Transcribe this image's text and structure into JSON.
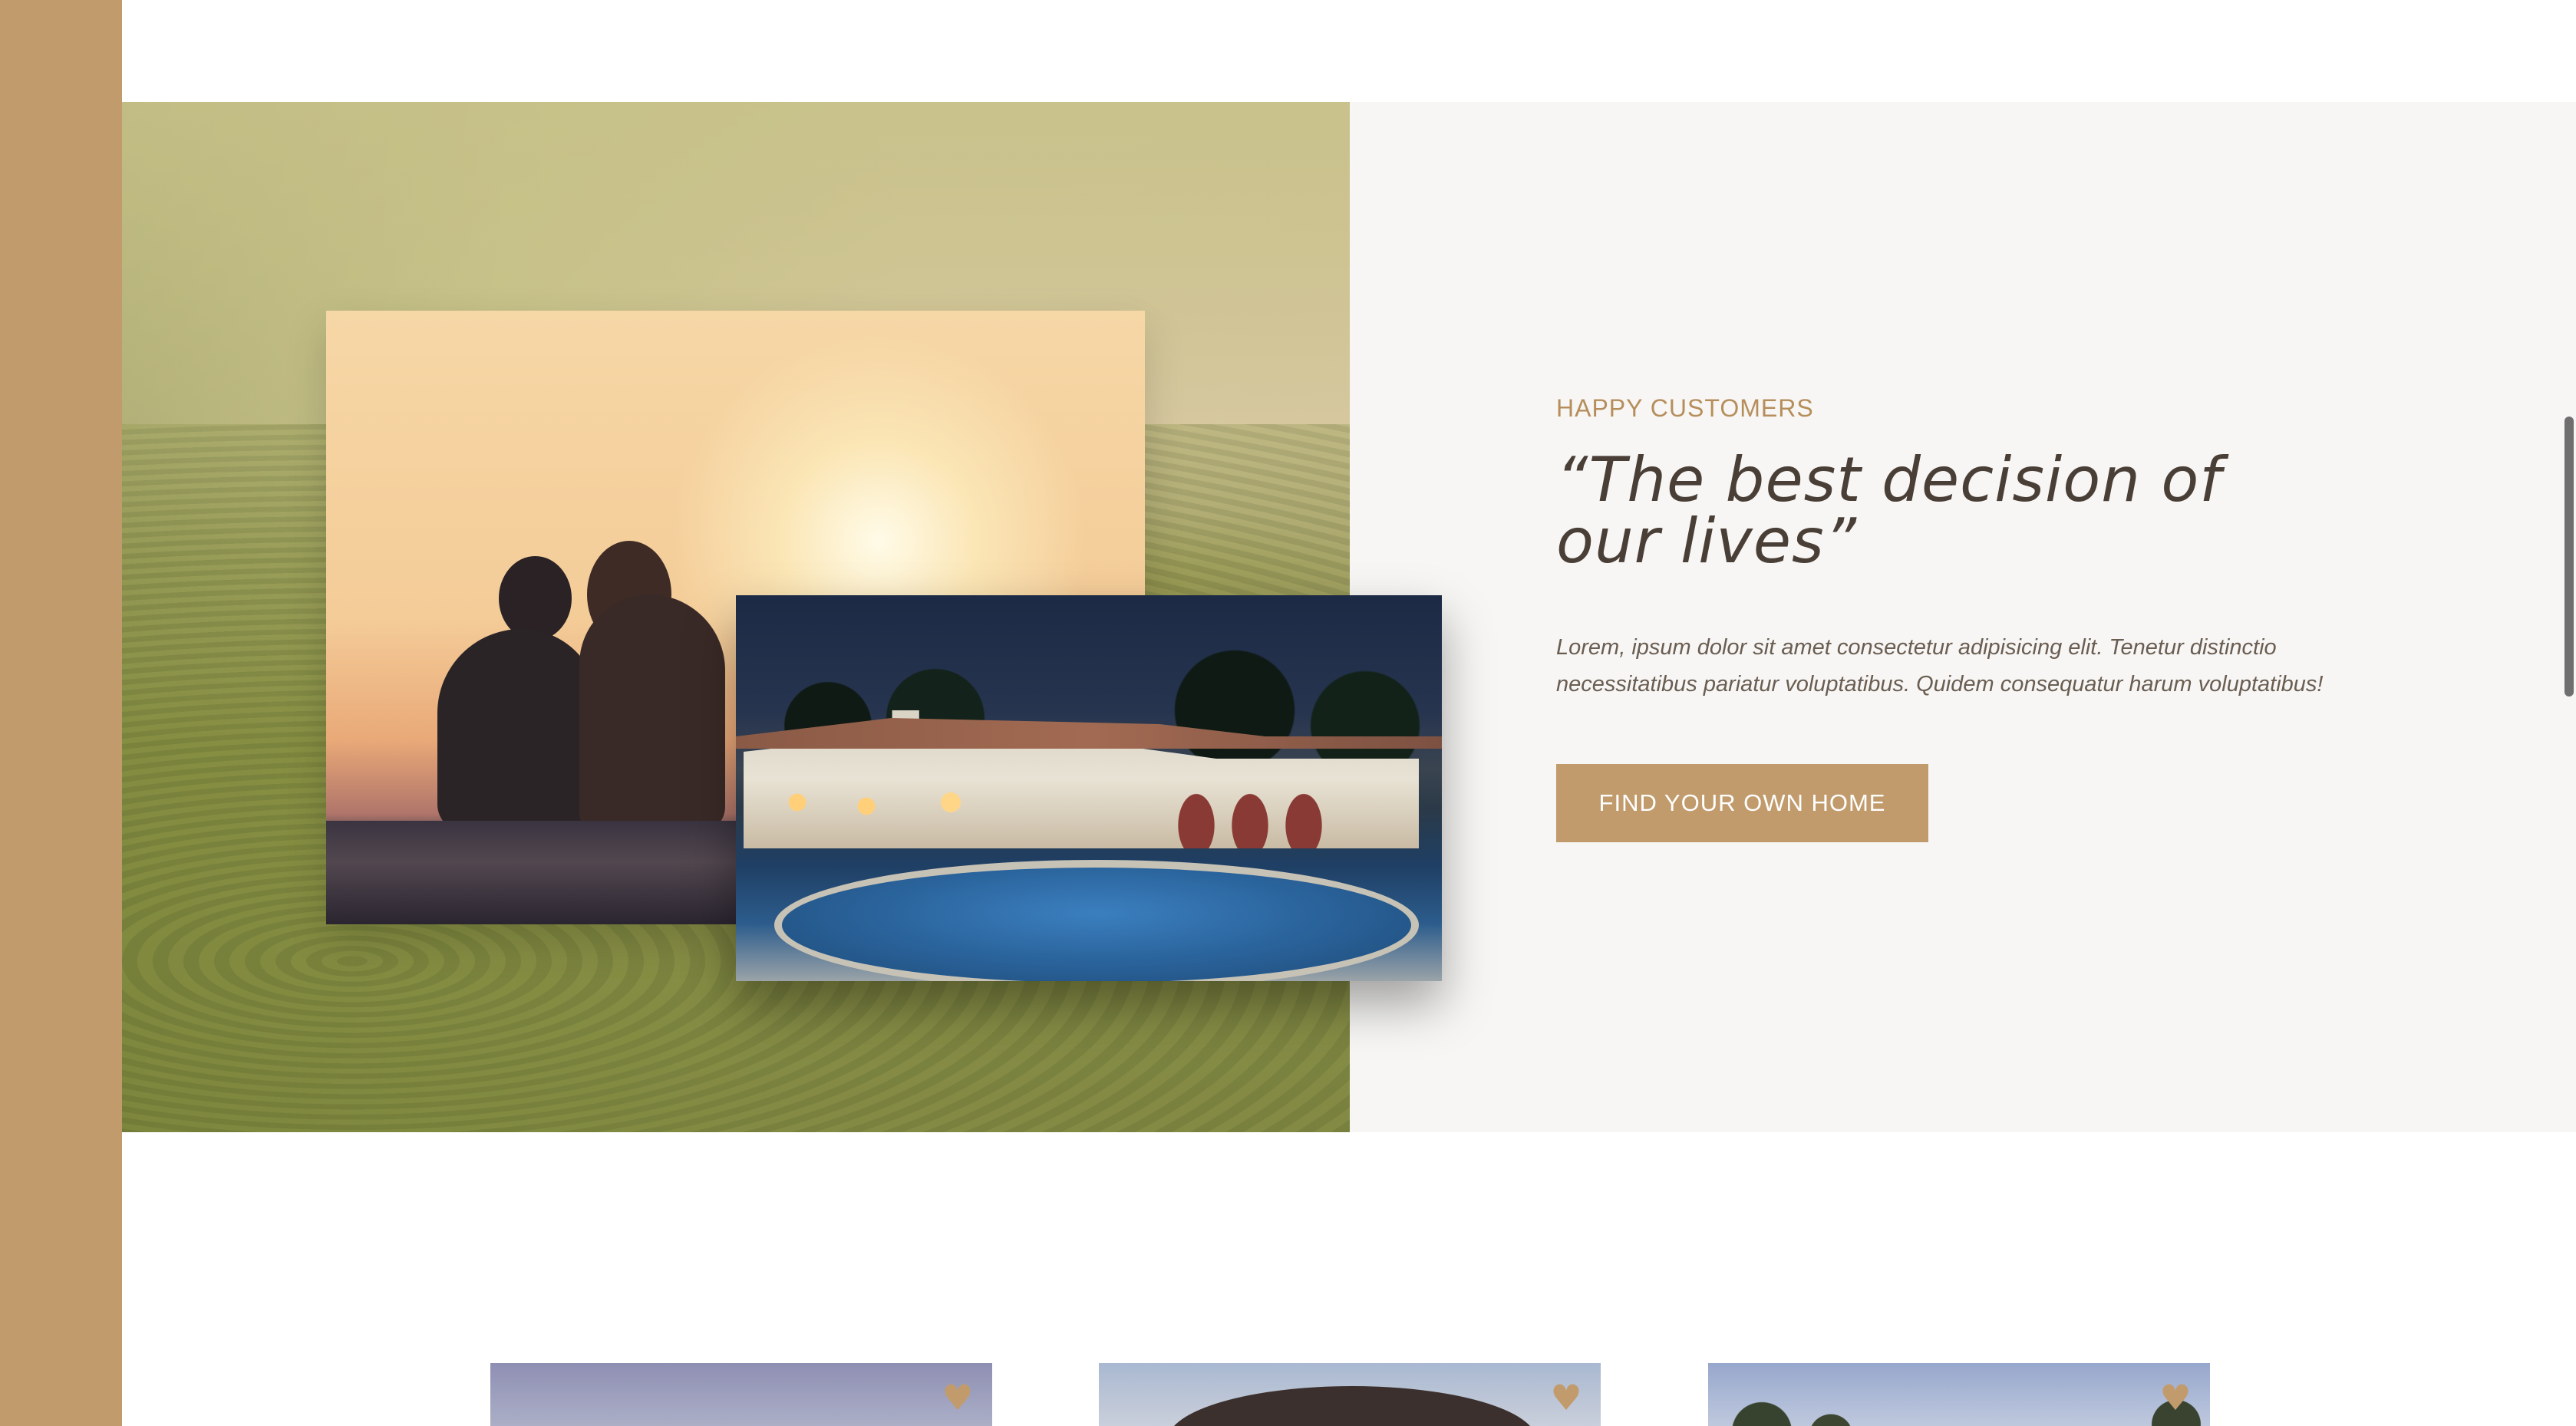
{
  "story": {
    "eyebrow": "HAPPY CUSTOMERS",
    "heading": "“The best decision of our lives”",
    "body": "Lorem, ipsum dolor sit amet consectetur adipisicing elit. Tenetur distinctio necessitatibus pariatur voluptatibus. Quidem consequatur harum voluptatibus!",
    "cta_label": "FIND YOUR OWN HOME"
  },
  "images": {
    "couple": "couple-sunset-photo",
    "villa": "villa-pool-photo",
    "background": "tea-hills-background"
  },
  "cards": [
    {
      "image": "property-photo-1",
      "favorite_icon": "heart-icon"
    },
    {
      "image": "property-photo-2",
      "favorite_icon": "heart-icon"
    },
    {
      "image": "property-photo-3",
      "favorite_icon": "heart-icon"
    }
  ],
  "colors": {
    "brand": "#c19b6c",
    "heading": "#4a3f37",
    "eyebrow": "#b68e5c",
    "panel_bg": "#f7f6f4"
  }
}
